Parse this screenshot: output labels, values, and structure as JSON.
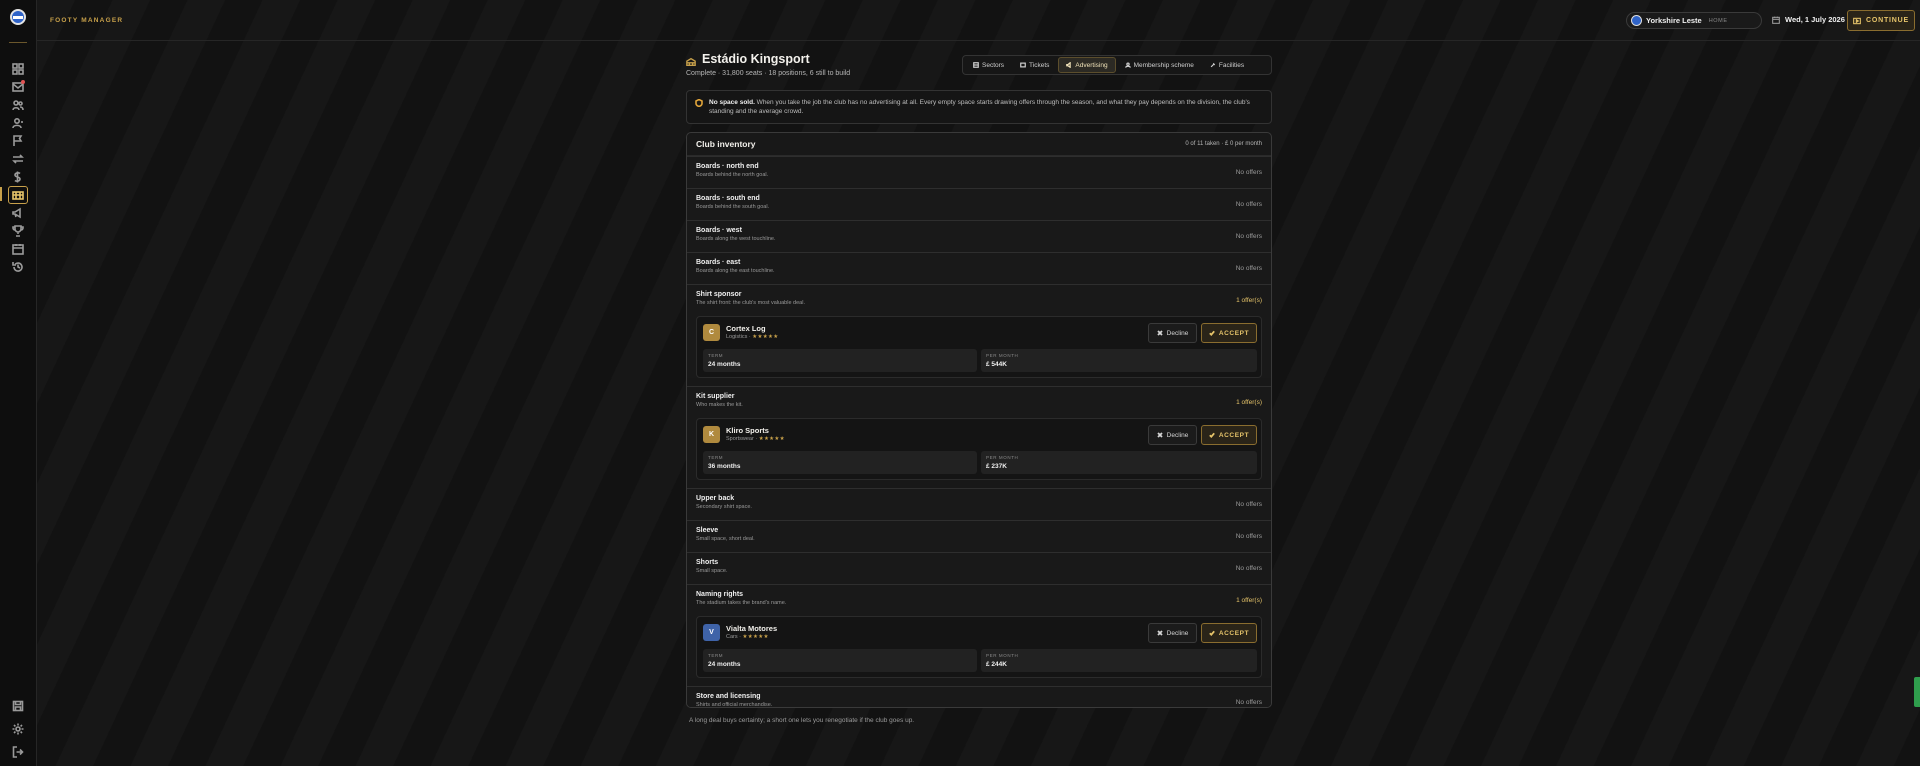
{
  "app": {
    "name": "FOOTY MANAGER"
  },
  "header": {
    "club_name": "Yorkshire Leste",
    "club_tag": "HOME",
    "date": "Wed, 1 July 2026",
    "continue_label": "CONTINUE"
  },
  "sidebar": {
    "icons": [
      "home-icon",
      "inbox-icon",
      "squad-icon",
      "staff-icon",
      "tactics-flag-icon",
      "transfers-icon",
      "finances-icon",
      "stadium-icon",
      "advertising-megaphone-icon",
      "trophy-icon",
      "calendar-icon",
      "history-icon"
    ],
    "bottom_icons": [
      "save-icon",
      "settings-icon",
      "logout-icon"
    ]
  },
  "page": {
    "title": "Estádio Kingsport",
    "subtitle": "Complete · 31,800 seats · 18 positions, 6 still to build",
    "tabs": [
      {
        "label": "Sectors"
      },
      {
        "label": "Tickets"
      },
      {
        "label": "Advertising"
      },
      {
        "label": "Membership scheme"
      },
      {
        "label": "Facilities"
      }
    ],
    "active_tab": "Advertising"
  },
  "notice": {
    "bold": "No space sold.",
    "text": " When you take the job the club has no advertising at all. Every empty space starts drawing offers through the season, and what they pay depends on the division, the club's standing and the average crowd."
  },
  "inventory": {
    "title": "Club inventory",
    "meta": "0 of 11 taken · £ 0 per month",
    "slots": [
      {
        "name": "Boards · north end",
        "desc": "Boards behind the north goal.",
        "status": "No offers"
      },
      {
        "name": "Boards · south end",
        "desc": "Boards behind the south goal.",
        "status": "No offers"
      },
      {
        "name": "Boards · west",
        "desc": "Boards along the west touchline.",
        "status": "No offers"
      },
      {
        "name": "Boards · east",
        "desc": "Boards along the east touchline.",
        "status": "No offers"
      },
      {
        "name": "Shirt sponsor",
        "desc": "The shirt front: the club's most valuable deal.",
        "status": "1 offer(s)",
        "offer": {
          "initial": "C",
          "name": "Cortex Log",
          "category": "Logistics",
          "stars": "★★★★★",
          "color": "#c7a04a",
          "term_label": "TERM",
          "term": "24 months",
          "month_label": "PER MONTH",
          "per_month": "£ 544K",
          "decline": "Decline",
          "accept": "ACCEPT"
        }
      },
      {
        "name": "Kit supplier",
        "desc": "Who makes the kit.",
        "status": "1 offer(s)",
        "offer": {
          "initial": "K",
          "name": "Kliro Sports",
          "category": "Sportswear",
          "stars": "★★★★★",
          "color": "#c7a04a",
          "term_label": "TERM",
          "term": "36 months",
          "month_label": "PER MONTH",
          "per_month": "£ 237K",
          "decline": "Decline",
          "accept": "ACCEPT"
        }
      },
      {
        "name": "Upper back",
        "desc": "Secondary shirt space.",
        "status": "No offers"
      },
      {
        "name": "Sleeve",
        "desc": "Small space, short deal.",
        "status": "No offers"
      },
      {
        "name": "Shorts",
        "desc": "Small space.",
        "status": "No offers"
      },
      {
        "name": "Naming rights",
        "desc": "The stadium takes the brand's name.",
        "status": "1 offer(s)",
        "offer": {
          "initial": "V",
          "name": "Vialta Motores",
          "category": "Cars",
          "stars": "★★★★★",
          "color": "#3f63a8",
          "term_label": "TERM",
          "term": "24 months",
          "month_label": "PER MONTH",
          "per_month": "£ 244K",
          "decline": "Decline",
          "accept": "ACCEPT"
        }
      },
      {
        "name": "Store and licensing",
        "desc": "Shirts and official merchandise.",
        "status": "No offers"
      }
    ]
  },
  "footnote": "A long deal buys certainty; a short one lets you renegotiate if the club goes up."
}
